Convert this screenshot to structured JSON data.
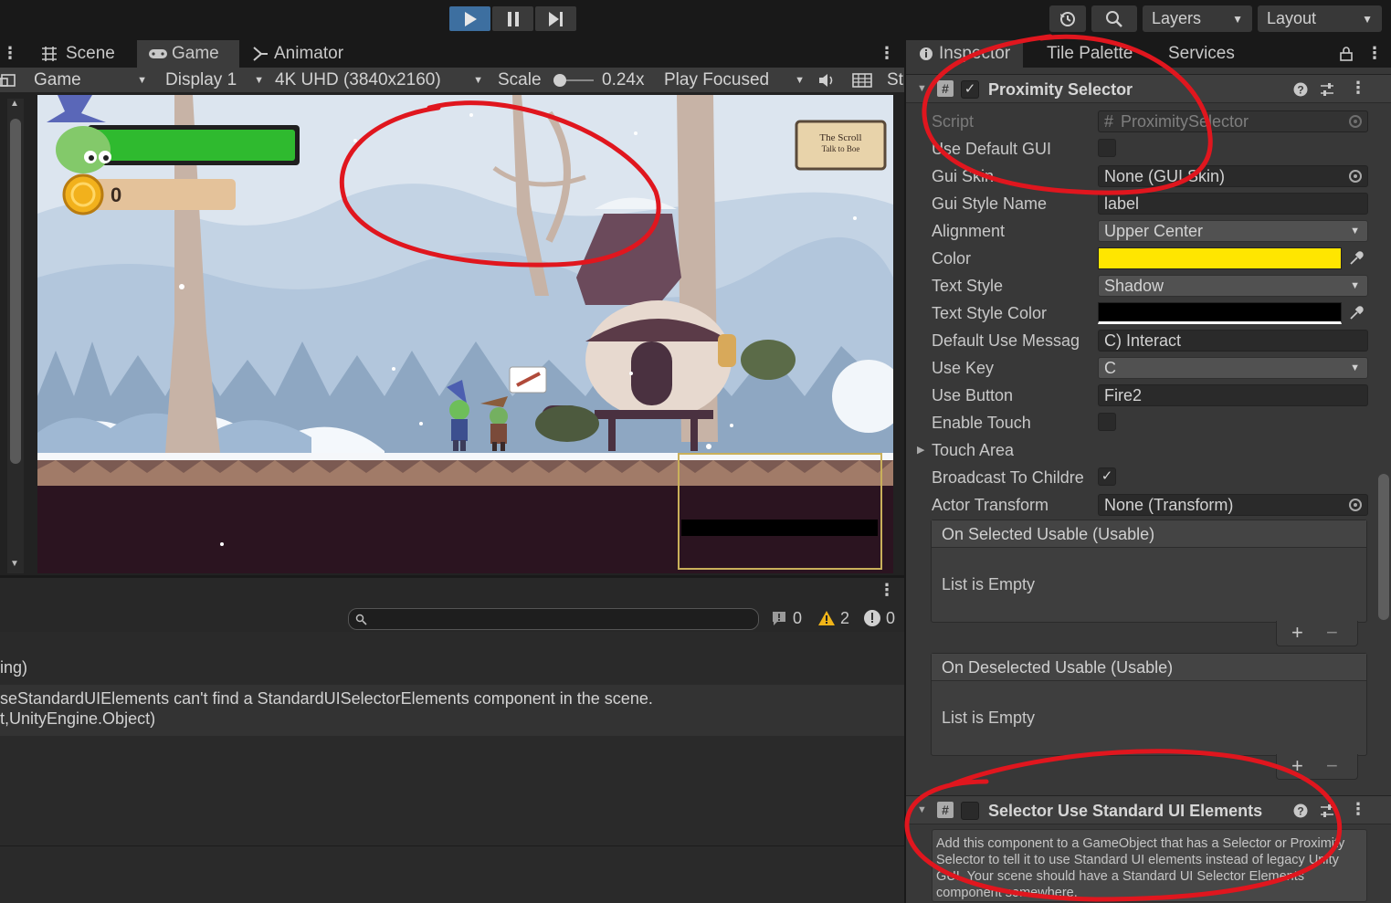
{
  "toolbar": {
    "layers_label": "Layers",
    "layout_label": "Layout"
  },
  "left_tabs": {
    "scene": "Scene",
    "game": "Game",
    "animator": "Animator"
  },
  "game_bar": {
    "view": "Game",
    "display": "Display 1",
    "resolution": "4K UHD (3840x2160)",
    "scale_label": "Scale",
    "scale_value": "0.24x",
    "play_mode": "Play Focused",
    "overflow_tab": "St"
  },
  "game_view": {
    "coin_count": "0",
    "scroll_sign_line1": "The Scroll",
    "scroll_sign_line2": "Talk to Boe"
  },
  "console": {
    "counts": {
      "info": "0",
      "warnings": "2",
      "errors": "0"
    },
    "logs": [
      "ing)",
      "seStandardUIElements can't find a StandardUISelectorElements component in the scene.",
      "t,UnityEngine.Object)"
    ]
  },
  "inspector_tabs": {
    "inspector": "Inspector",
    "tile_palette": "Tile Palette",
    "services": "Services"
  },
  "proximity_selector": {
    "title": "Proximity Selector",
    "props": {
      "script_label": "Script",
      "script_value": "ProximitySelector",
      "use_default_gui_label": "Use Default GUI",
      "gui_skin_label": "Gui Skin",
      "gui_skin_value": "None (GUI Skin)",
      "gui_style_name_label": "Gui Style Name",
      "gui_style_name_value": "label",
      "alignment_label": "Alignment",
      "alignment_value": "Upper Center",
      "color_label": "Color",
      "text_style_label": "Text Style",
      "text_style_value": "Shadow",
      "text_style_color_label": "Text Style Color",
      "default_use_message_label": "Default Use Messag",
      "default_use_message_value": "C) Interact",
      "use_key_label": "Use Key",
      "use_key_value": "C",
      "use_button_label": "Use Button",
      "use_button_value": "Fire2",
      "enable_touch_label": "Enable Touch",
      "touch_area_label": "Touch Area",
      "broadcast_label": "Broadcast To Childre",
      "actor_transform_label": "Actor Transform",
      "actor_transform_value": "None (Transform)"
    },
    "colors": {
      "color": "#ffe600",
      "text_style_color": "#000000"
    },
    "events": [
      {
        "title": "On Selected Usable (Usable)",
        "empty": "List is Empty"
      },
      {
        "title": "On Deselected Usable (Usable)",
        "empty": "List is Empty"
      }
    ]
  },
  "selector_ui": {
    "title": "Selector Use Standard UI Elements",
    "help": "Add this component to a GameObject that has a Selector or Proximity Selector to tell it to use Standard UI elements instead of legacy Unity GUI. Your scene should have a Standard UI Selector Elements component somewhere."
  }
}
